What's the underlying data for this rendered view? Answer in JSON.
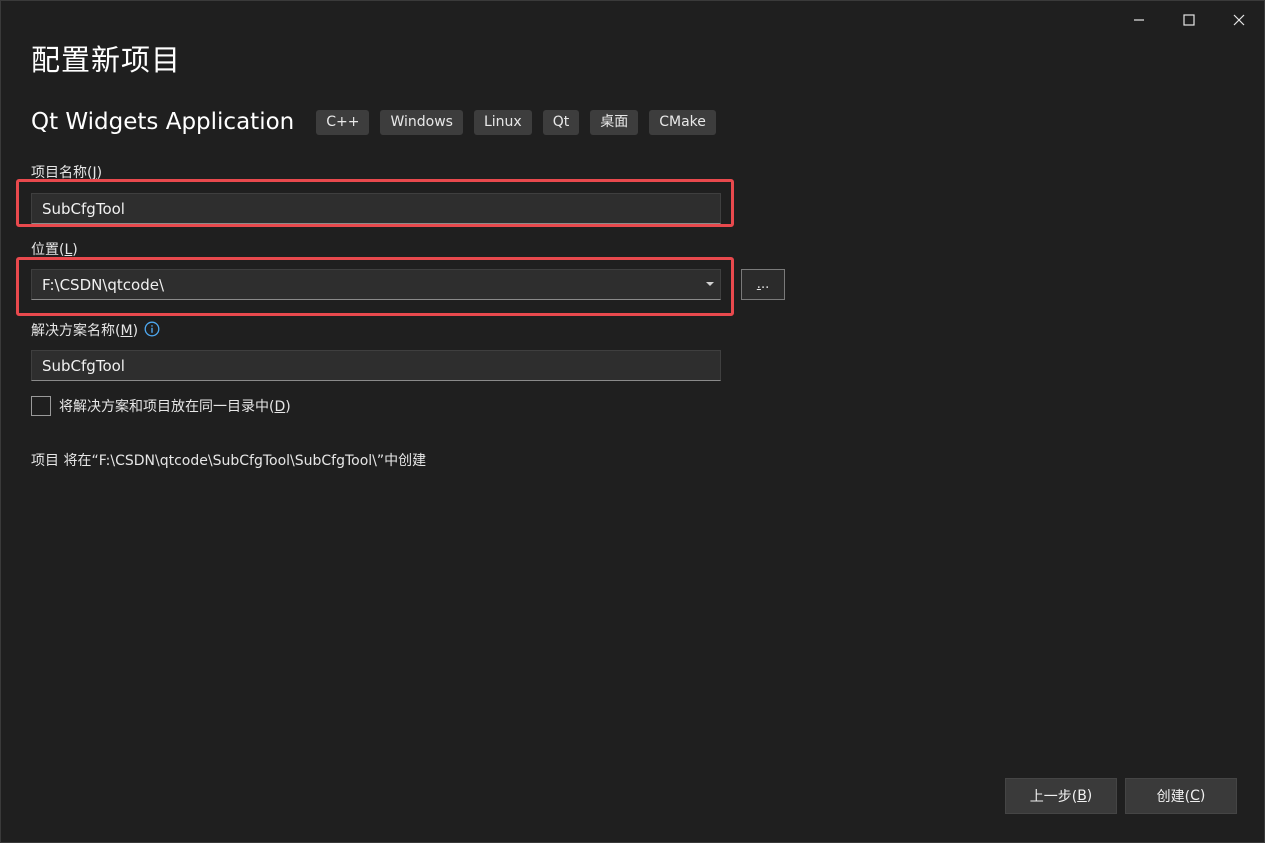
{
  "window": {
    "minimize_icon": "minimize-icon",
    "maximize_icon": "maximize-icon",
    "close_icon": "close-icon"
  },
  "page_title": "配置新项目",
  "template": {
    "name": "Qt Widgets Application",
    "tags": [
      "C++",
      "Windows",
      "Linux",
      "Qt",
      "桌面",
      "CMake"
    ]
  },
  "project_name": {
    "label_prefix": "项目名称(",
    "label_key": "J",
    "label_suffix": ")",
    "value": "SubCfgTool"
  },
  "location": {
    "label_prefix": "位置(",
    "label_key": "L",
    "label_suffix": ")",
    "value": "F:\\CSDN\\qtcode\\",
    "browse_label_key": ".",
    "browse_label_rest": ".."
  },
  "solution_name": {
    "label_prefix": "解决方案名称(",
    "label_key": "M",
    "label_suffix": ")",
    "value": "SubCfgTool",
    "info_icon": "info-icon"
  },
  "same_dir": {
    "label_prefix": "将解决方案和项目放在同一目录中(",
    "label_key": "D",
    "label_suffix": ")",
    "checked": false
  },
  "creation_info": "项目 将在“F:\\CSDN\\qtcode\\SubCfgTool\\SubCfgTool\\”中创建",
  "footer": {
    "back_prefix": "上一步(",
    "back_key": "B",
    "back_suffix": ")",
    "create_prefix": "创建(",
    "create_key": "C",
    "create_suffix": ")"
  },
  "colors": {
    "background": "#1f1f1f",
    "highlight": "#e8494d",
    "info_icon": "#4ea8f0"
  }
}
